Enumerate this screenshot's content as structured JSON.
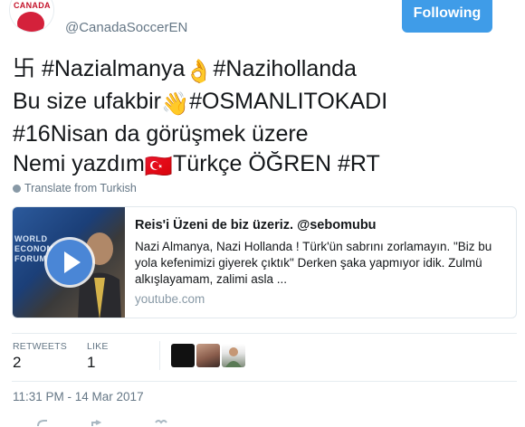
{
  "header": {
    "avatar_text": "CANADA",
    "handle": "@CanadaSoccerEN",
    "follow_label": "Following"
  },
  "tweet": {
    "lines": [
      {
        "lead_glyph": "卐",
        "text_a": " #Nazialmanya",
        "emoji": "👌",
        "text_b": "#Nazihollanda"
      },
      {
        "text_a": "Bu size ufakbir",
        "emoji": "👋",
        "text_b": "#OSMANLITOKADI"
      },
      {
        "text_a": "#16Nisan da görüşmek üzere"
      },
      {
        "text_a": "Nemi yazdım",
        "emoji": "🇹🇷",
        "text_b": "Türkçe ÖĞREN #RT"
      }
    ],
    "translate_label": "Translate from Turkish"
  },
  "card": {
    "thumb_text": "WORLD ECONOMIC FORUM",
    "title": "Reis'i Üzeni de biz üzeriz. @sebomubu",
    "description": "Nazi Almanya, Nazi Hollanda ! Türk'ün sabrını zorlamayın. \"Biz bu yola kefenimizi giyerek çıktık\" Derken şaka yapmıyor idik. Zulmü alkışlayamam, zalimi asla ...",
    "domain": "youtube.com"
  },
  "stats": {
    "retweets_label": "RETWEETS",
    "retweets_value": "2",
    "likes_label": "LIKE",
    "likes_value": "1"
  },
  "timestamp": "11:31 PM - 14 Mar 2017",
  "colors": {
    "accent": "#3f9ce8",
    "muted": "#657786",
    "text": "#14171a",
    "border": "#e1e8ed"
  }
}
